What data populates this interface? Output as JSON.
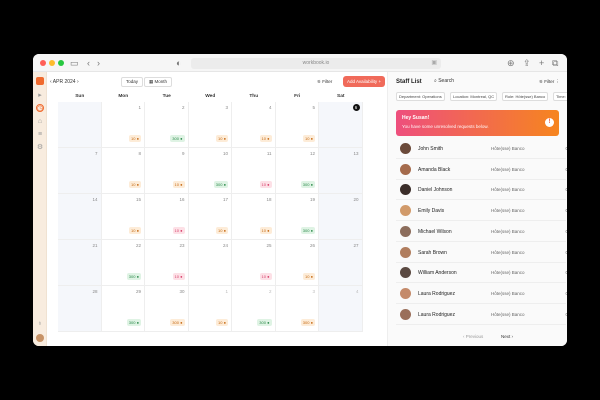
{
  "browser": {
    "url": "workbook.io"
  },
  "calendar": {
    "month_label": "APR 2024",
    "today_label": "Today",
    "view_label": "Month",
    "filter_label": "Filter",
    "add_label": "Add Availability",
    "days": [
      "Sun",
      "Mon",
      "Tue",
      "Wed",
      "Thu",
      "Fri",
      "Sat"
    ],
    "weeks": [
      [
        "",
        "1",
        "2",
        "3",
        "4",
        "5",
        "6"
      ],
      [
        "7",
        "8",
        "9",
        "10",
        "11",
        "12",
        "13"
      ],
      [
        "14",
        "15",
        "16",
        "17",
        "18",
        "19",
        "20"
      ],
      [
        "21",
        "22",
        "23",
        "24",
        "25",
        "26",
        "27"
      ],
      [
        "28",
        "29",
        "30",
        "1",
        "2",
        "3",
        "4"
      ]
    ],
    "badges": [
      [
        "",
        "10",
        "300",
        "10",
        "10",
        "10",
        ""
      ],
      [
        "",
        "10",
        "10",
        "300",
        "10",
        "300",
        ""
      ],
      [
        "",
        "10",
        "10",
        "10",
        "10",
        "300",
        ""
      ],
      [
        "",
        "300",
        "10",
        "",
        "10",
        "10",
        ""
      ],
      [
        "",
        "300",
        "300",
        "10",
        "300",
        "300",
        ""
      ]
    ],
    "badge_types": [
      [
        "",
        "o",
        "g",
        "o",
        "o",
        "o",
        ""
      ],
      [
        "",
        "o",
        "o",
        "g",
        "p",
        "g",
        ""
      ],
      [
        "",
        "o",
        "p",
        "o",
        "o",
        "g",
        ""
      ],
      [
        "",
        "g",
        "p",
        "",
        "p",
        "o",
        ""
      ],
      [
        "",
        "g",
        "o",
        "o",
        "g",
        "o",
        ""
      ]
    ]
  },
  "staff_panel": {
    "title": "Staff List",
    "search_label": "Search",
    "filter_label": "Filter",
    "chips": [
      "Department: Operations",
      "Location: Montreal, QC",
      "Role: Hôte(sse) Banco",
      "Time: 6+ hours"
    ],
    "banner_title": "Hey Susan!",
    "banner_message": "You have some unresolved requests below.",
    "staff": [
      {
        "name": "John Smith",
        "role": "Hôte(sse) Banco",
        "id": "001"
      },
      {
        "name": "Amanda Black",
        "role": "Hôte(sse) Banco",
        "id": "002"
      },
      {
        "name": "Daniel Johnson",
        "role": "Hôte(sse) Banco",
        "id": "003"
      },
      {
        "name": "Emily Davis",
        "role": "Hôte(sse) Banco",
        "id": "004"
      },
      {
        "name": "Michael Wilson",
        "role": "Hôte(sse) Banco",
        "id": "005"
      },
      {
        "name": "Sarah Brown",
        "role": "Hôte(sse) Banco",
        "id": "006"
      },
      {
        "name": "William Anderson",
        "role": "Hôte(sse) Banco",
        "id": "007"
      },
      {
        "name": "Laura Rodriguez",
        "role": "Hôte(sse) Banco",
        "id": "008"
      },
      {
        "name": "Laura Rodriguez",
        "role": "Hôte(sse) Banco",
        "id": "009"
      }
    ],
    "prev_label": "Previous",
    "next_label": "Next"
  }
}
